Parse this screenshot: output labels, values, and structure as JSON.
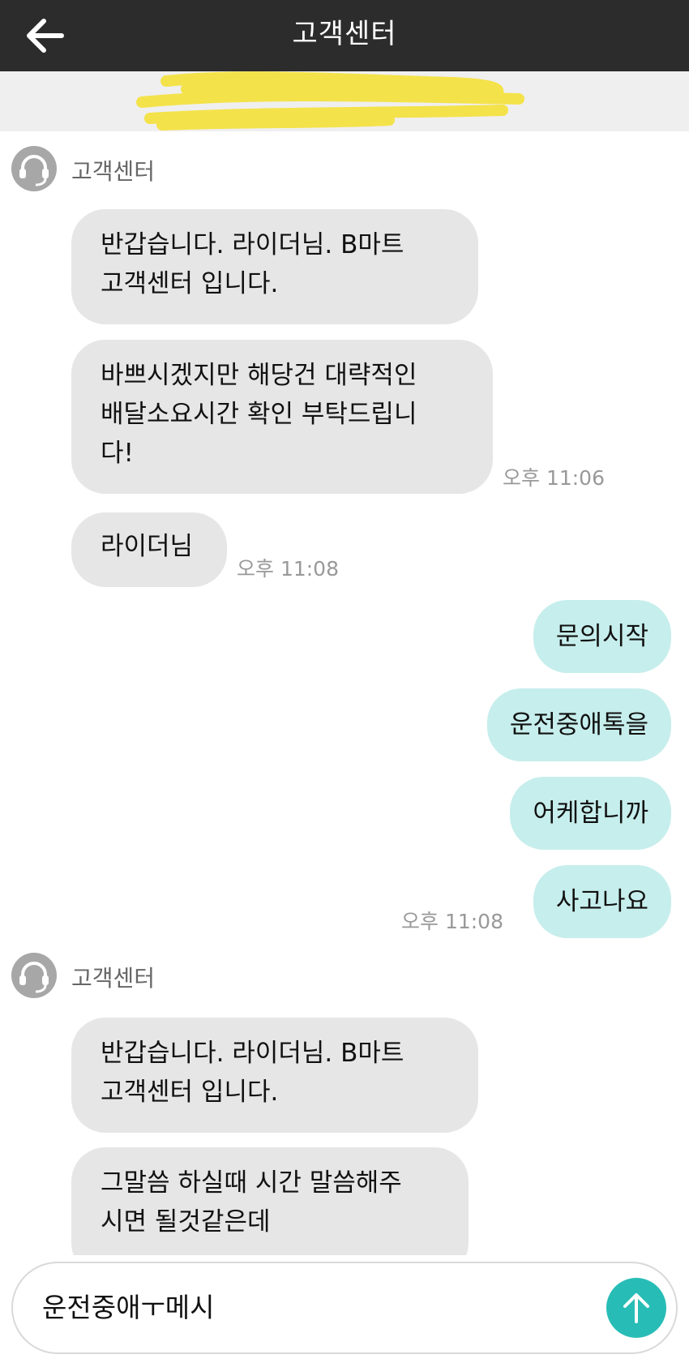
{
  "header": {
    "title": "고객센터"
  },
  "icons": {
    "back": "arrow-left-icon",
    "avatar": "headset-icon",
    "send": "arrow-up-icon"
  },
  "colors": {
    "header_bg": "#2c2c2c",
    "incoming_bubble": "#e6e6e6",
    "outgoing_bubble": "#c6eeec",
    "send_button": "#27bdb6",
    "redaction": "#f4e24a"
  },
  "messages": {
    "group1": {
      "sender": "고객센터",
      "m1": "반갑습니다. 라이더님. B마트\n고객센터 입니다.",
      "m2": "바쁘시겠지만 해당건 대략적인\n배달소요시간 확인 부탁드립니\n다!",
      "m2_time": "오후 11:06",
      "m3": "라이더님",
      "m3_time": "오후 11:08"
    },
    "outgoing": {
      "o1": "문의시작",
      "o2": "운전중애톡을",
      "o3": "어케합니까",
      "o4": "사고나요",
      "o4_time": "오후 11:08"
    },
    "group2": {
      "sender": "고객센터",
      "m1": "반갑습니다. 라이더님. B마트\n고객센터 입니다.",
      "m2": "그말씀 하실때 시간 말씀해주\n시면 될것같은데"
    }
  },
  "composer": {
    "value": "운전중애ㅜ메시"
  }
}
